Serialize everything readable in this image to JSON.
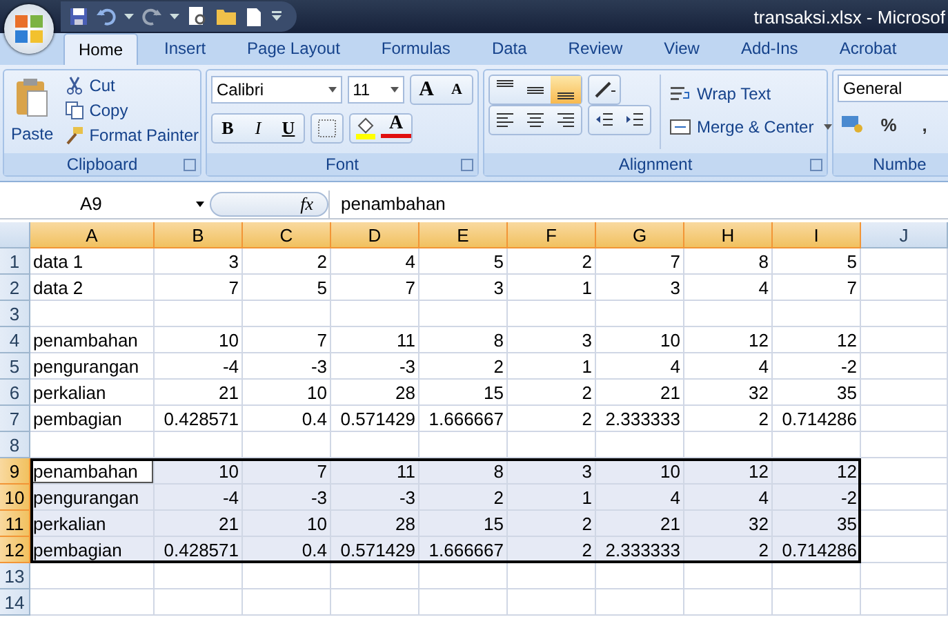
{
  "window": {
    "title": "transaksi.xlsx - Microsof"
  },
  "tabs": [
    {
      "label": "Home",
      "selected": true
    },
    {
      "label": "Insert",
      "selected": false
    },
    {
      "label": "Page Layout",
      "selected": false
    },
    {
      "label": "Formulas",
      "selected": false
    },
    {
      "label": "Data",
      "selected": false
    },
    {
      "label": "Review",
      "selected": false
    },
    {
      "label": "View",
      "selected": false
    },
    {
      "label": "Add-Ins",
      "selected": false
    },
    {
      "label": "Acrobat",
      "selected": false
    }
  ],
  "ribbon": {
    "clipboard": {
      "title": "Clipboard",
      "paste": "Paste",
      "cut": "Cut",
      "copy": "Copy",
      "format_painter": "Format Painter"
    },
    "font": {
      "title": "Font",
      "font_name": "Calibri",
      "font_size": "11",
      "grow": "A",
      "shrink": "A",
      "bold": "B",
      "italic": "I",
      "underline": "U",
      "font_color_label": "A"
    },
    "alignment": {
      "title": "Alignment",
      "valign_buttons": [
        {
          "selected": false
        },
        {
          "selected": false
        },
        {
          "selected": true
        }
      ],
      "wrap_text": "Wrap Text",
      "merge_center": "Merge & Center"
    },
    "number": {
      "title": "Numbe",
      "format": "General",
      "percent": "%",
      "comma": ","
    }
  },
  "formula_bar": {
    "name_box": "A9",
    "fx": "fx",
    "value": "penambahan"
  },
  "columns": [
    {
      "label": "A",
      "selected": true
    },
    {
      "label": "B",
      "selected": true
    },
    {
      "label": "C",
      "selected": true
    },
    {
      "label": "D",
      "selected": true
    },
    {
      "label": "E",
      "selected": true
    },
    {
      "label": "F",
      "selected": true
    },
    {
      "label": "G",
      "selected": true
    },
    {
      "label": "H",
      "selected": true
    },
    {
      "label": "I",
      "selected": true
    },
    {
      "label": "J",
      "selected": false
    }
  ],
  "rows": [
    {
      "header": "1",
      "selected": false,
      "active": false,
      "cells": [
        "data 1",
        "3",
        "2",
        "4",
        "5",
        "2",
        "7",
        "8",
        "5"
      ]
    },
    {
      "header": "2",
      "selected": false,
      "active": false,
      "cells": [
        "data 2",
        "7",
        "5",
        "7",
        "3",
        "1",
        "3",
        "4",
        "7"
      ]
    },
    {
      "header": "3",
      "selected": false,
      "active": false
    },
    {
      "header": "4",
      "selected": false,
      "active": false,
      "cells": [
        "penambahan",
        "10",
        "7",
        "11",
        "8",
        "3",
        "10",
        "12",
        "12"
      ]
    },
    {
      "header": "5",
      "selected": false,
      "active": false,
      "cells": [
        "pengurangan",
        "-4",
        "-3",
        "-3",
        "2",
        "1",
        "4",
        "4",
        "-2"
      ]
    },
    {
      "header": "6",
      "selected": false,
      "active": false,
      "cells": [
        "perkalian",
        "21",
        "10",
        "28",
        "15",
        "2",
        "21",
        "32",
        "35"
      ]
    },
    {
      "header": "7",
      "selected": false,
      "active": false,
      "cells": [
        "pembagian",
        "0.428571",
        "0.4",
        "0.571429",
        "1.666667",
        "2",
        "2.333333",
        "2",
        "0.714286"
      ]
    },
    {
      "header": "8",
      "selected": false,
      "active": false
    },
    {
      "header": "9",
      "selected": true,
      "active": true,
      "cells": [
        "penambahan",
        "10",
        "7",
        "11",
        "8",
        "3",
        "10",
        "12",
        "12"
      ]
    },
    {
      "header": "10",
      "selected": true,
      "active": false,
      "cells": [
        "pengurangan",
        "-4",
        "-3",
        "-3",
        "2",
        "1",
        "4",
        "4",
        "-2"
      ]
    },
    {
      "header": "11",
      "selected": true,
      "active": false,
      "cells": [
        "perkalian",
        "21",
        "10",
        "28",
        "15",
        "2",
        "21",
        "32",
        "35"
      ]
    },
    {
      "header": "12",
      "selected": true,
      "active": false,
      "cells": [
        "pembagian",
        "0.428571",
        "0.4",
        "0.571429",
        "1.666667",
        "2",
        "2.333333",
        "2",
        "0.714286"
      ]
    },
    {
      "header": "13",
      "selected": false,
      "active": false
    },
    {
      "header": "14",
      "selected": false,
      "active": false
    }
  ]
}
